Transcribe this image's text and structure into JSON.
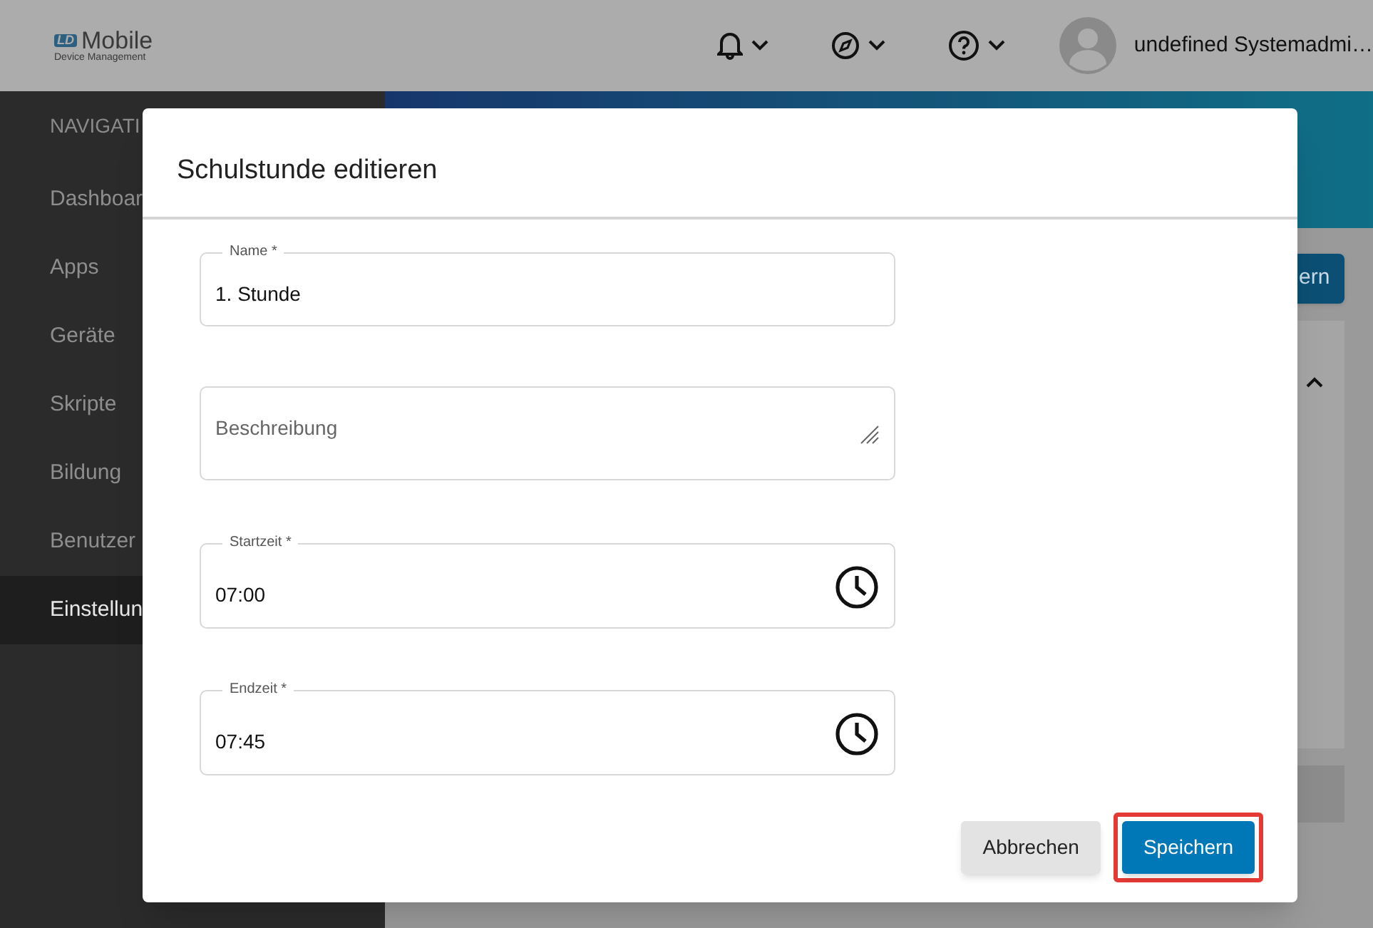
{
  "header": {
    "logo": {
      "badge": "LD",
      "name": "Mobile",
      "subtitle": "Device Management"
    },
    "user": "undefined Systemadmi…"
  },
  "sidebar": {
    "heading": "NAVIGATI",
    "items": [
      {
        "label": "Dashboar",
        "selected": false
      },
      {
        "label": "Apps",
        "selected": false
      },
      {
        "label": "Geräte",
        "selected": false
      },
      {
        "label": "Skripte",
        "selected": false
      },
      {
        "label": "Bildung",
        "selected": false
      },
      {
        "label": "Benutzer",
        "selected": false
      },
      {
        "label": "Einstellun",
        "selected": true
      }
    ]
  },
  "background": {
    "button": "ern"
  },
  "dialog": {
    "title": "Schulstunde editieren",
    "fields": [
      {
        "kind": "text",
        "label": "Name *",
        "value": "1. Stunde"
      },
      {
        "kind": "textarea",
        "placeholder": "Beschreibung"
      },
      {
        "kind": "time",
        "label": "Startzeit *",
        "value": "07:00"
      },
      {
        "kind": "time",
        "label": "Endzeit *",
        "value": "07:45"
      }
    ],
    "buttons": [
      {
        "label": "Abbrechen",
        "kind": "secondary",
        "highlighted": false
      },
      {
        "label": "Speichern",
        "kind": "primary",
        "highlighted": true
      }
    ]
  }
}
